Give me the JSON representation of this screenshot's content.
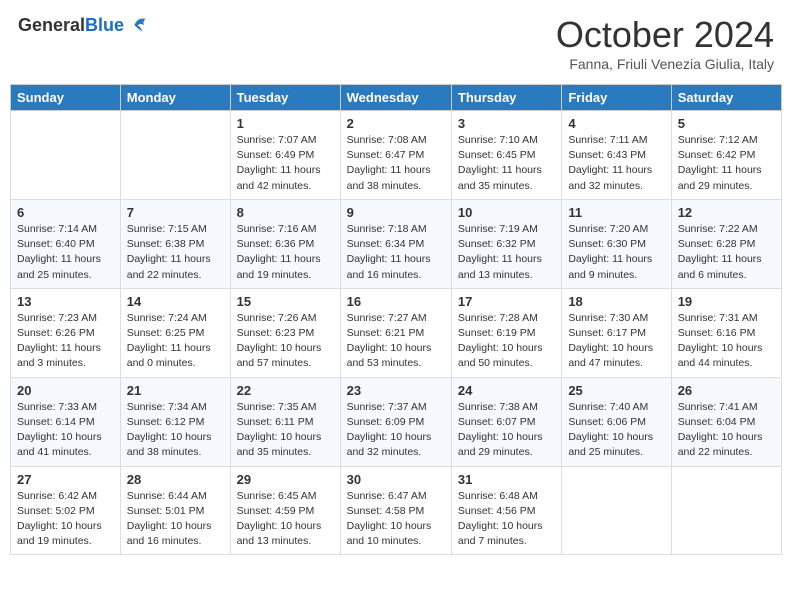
{
  "header": {
    "logo_general": "General",
    "logo_blue": "Blue",
    "month": "October 2024",
    "location": "Fanna, Friuli Venezia Giulia, Italy"
  },
  "weekdays": [
    "Sunday",
    "Monday",
    "Tuesday",
    "Wednesday",
    "Thursday",
    "Friday",
    "Saturday"
  ],
  "weeks": [
    [
      {
        "day": "",
        "info": ""
      },
      {
        "day": "",
        "info": ""
      },
      {
        "day": "1",
        "info": "Sunrise: 7:07 AM\nSunset: 6:49 PM\nDaylight: 11 hours and 42 minutes."
      },
      {
        "day": "2",
        "info": "Sunrise: 7:08 AM\nSunset: 6:47 PM\nDaylight: 11 hours and 38 minutes."
      },
      {
        "day": "3",
        "info": "Sunrise: 7:10 AM\nSunset: 6:45 PM\nDaylight: 11 hours and 35 minutes."
      },
      {
        "day": "4",
        "info": "Sunrise: 7:11 AM\nSunset: 6:43 PM\nDaylight: 11 hours and 32 minutes."
      },
      {
        "day": "5",
        "info": "Sunrise: 7:12 AM\nSunset: 6:42 PM\nDaylight: 11 hours and 29 minutes."
      }
    ],
    [
      {
        "day": "6",
        "info": "Sunrise: 7:14 AM\nSunset: 6:40 PM\nDaylight: 11 hours and 25 minutes."
      },
      {
        "day": "7",
        "info": "Sunrise: 7:15 AM\nSunset: 6:38 PM\nDaylight: 11 hours and 22 minutes."
      },
      {
        "day": "8",
        "info": "Sunrise: 7:16 AM\nSunset: 6:36 PM\nDaylight: 11 hours and 19 minutes."
      },
      {
        "day": "9",
        "info": "Sunrise: 7:18 AM\nSunset: 6:34 PM\nDaylight: 11 hours and 16 minutes."
      },
      {
        "day": "10",
        "info": "Sunrise: 7:19 AM\nSunset: 6:32 PM\nDaylight: 11 hours and 13 minutes."
      },
      {
        "day": "11",
        "info": "Sunrise: 7:20 AM\nSunset: 6:30 PM\nDaylight: 11 hours and 9 minutes."
      },
      {
        "day": "12",
        "info": "Sunrise: 7:22 AM\nSunset: 6:28 PM\nDaylight: 11 hours and 6 minutes."
      }
    ],
    [
      {
        "day": "13",
        "info": "Sunrise: 7:23 AM\nSunset: 6:26 PM\nDaylight: 11 hours and 3 minutes."
      },
      {
        "day": "14",
        "info": "Sunrise: 7:24 AM\nSunset: 6:25 PM\nDaylight: 11 hours and 0 minutes."
      },
      {
        "day": "15",
        "info": "Sunrise: 7:26 AM\nSunset: 6:23 PM\nDaylight: 10 hours and 57 minutes."
      },
      {
        "day": "16",
        "info": "Sunrise: 7:27 AM\nSunset: 6:21 PM\nDaylight: 10 hours and 53 minutes."
      },
      {
        "day": "17",
        "info": "Sunrise: 7:28 AM\nSunset: 6:19 PM\nDaylight: 10 hours and 50 minutes."
      },
      {
        "day": "18",
        "info": "Sunrise: 7:30 AM\nSunset: 6:17 PM\nDaylight: 10 hours and 47 minutes."
      },
      {
        "day": "19",
        "info": "Sunrise: 7:31 AM\nSunset: 6:16 PM\nDaylight: 10 hours and 44 minutes."
      }
    ],
    [
      {
        "day": "20",
        "info": "Sunrise: 7:33 AM\nSunset: 6:14 PM\nDaylight: 10 hours and 41 minutes."
      },
      {
        "day": "21",
        "info": "Sunrise: 7:34 AM\nSunset: 6:12 PM\nDaylight: 10 hours and 38 minutes."
      },
      {
        "day": "22",
        "info": "Sunrise: 7:35 AM\nSunset: 6:11 PM\nDaylight: 10 hours and 35 minutes."
      },
      {
        "day": "23",
        "info": "Sunrise: 7:37 AM\nSunset: 6:09 PM\nDaylight: 10 hours and 32 minutes."
      },
      {
        "day": "24",
        "info": "Sunrise: 7:38 AM\nSunset: 6:07 PM\nDaylight: 10 hours and 29 minutes."
      },
      {
        "day": "25",
        "info": "Sunrise: 7:40 AM\nSunset: 6:06 PM\nDaylight: 10 hours and 25 minutes."
      },
      {
        "day": "26",
        "info": "Sunrise: 7:41 AM\nSunset: 6:04 PM\nDaylight: 10 hours and 22 minutes."
      }
    ],
    [
      {
        "day": "27",
        "info": "Sunrise: 6:42 AM\nSunset: 5:02 PM\nDaylight: 10 hours and 19 minutes."
      },
      {
        "day": "28",
        "info": "Sunrise: 6:44 AM\nSunset: 5:01 PM\nDaylight: 10 hours and 16 minutes."
      },
      {
        "day": "29",
        "info": "Sunrise: 6:45 AM\nSunset: 4:59 PM\nDaylight: 10 hours and 13 minutes."
      },
      {
        "day": "30",
        "info": "Sunrise: 6:47 AM\nSunset: 4:58 PM\nDaylight: 10 hours and 10 minutes."
      },
      {
        "day": "31",
        "info": "Sunrise: 6:48 AM\nSunset: 4:56 PM\nDaylight: 10 hours and 7 minutes."
      },
      {
        "day": "",
        "info": ""
      },
      {
        "day": "",
        "info": ""
      }
    ]
  ]
}
